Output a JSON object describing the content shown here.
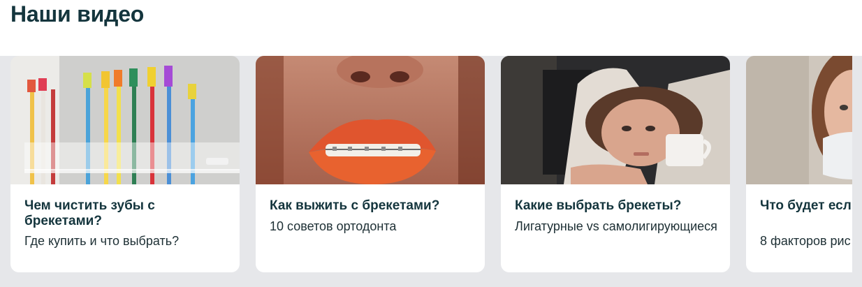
{
  "section": {
    "title": "Наши видео"
  },
  "cards": [
    {
      "title": "Чем чистить зубы с брекетами?",
      "subtitle": "Где купить и что выбрать?",
      "image_icon": "toothbrushes-photo"
    },
    {
      "title": "Как выжить с брекетами?",
      "subtitle": "10 советов ортодонта",
      "image_icon": "lips-with-braces-photo"
    },
    {
      "title": "Какие выбрать брекеты?",
      "subtitle": "Лигатурные vs самолигирующиеся",
      "image_icon": "tired-woman-photo"
    },
    {
      "title": "Что будет если брекеты?",
      "subtitle": "8 факторов рис",
      "image_icon": "woman-in-mask-photo"
    }
  ]
}
